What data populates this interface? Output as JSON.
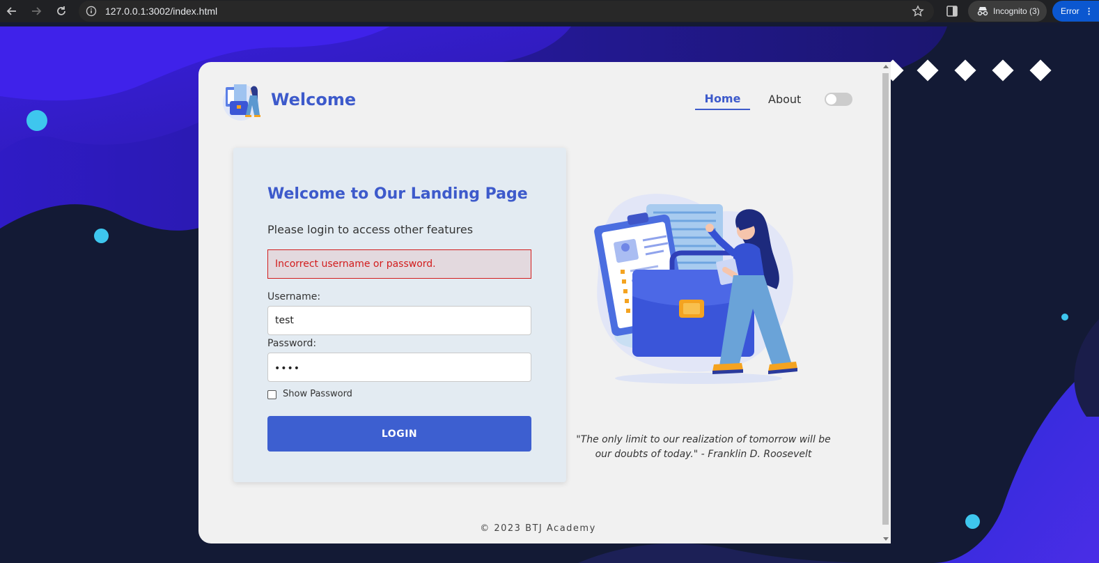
{
  "browser": {
    "url": "127.0.0.1:3002/index.html",
    "incognito_label": "Incognito (3)",
    "error_label": "Error",
    "icons": {
      "back": "arrow-left-icon",
      "forward": "arrow-right-icon",
      "reload": "reload-icon",
      "site_info": "info-icon",
      "bookmark": "star-icon",
      "side_panel": "side-panel-icon",
      "incognito": "incognito-icon",
      "menu": "kebab-menu-icon"
    }
  },
  "header": {
    "brand": "Welcome",
    "nav": {
      "home": "Home",
      "about": "About"
    },
    "theme_toggle_on": false
  },
  "login": {
    "title": "Welcome to Our Landing Page",
    "subtitle": "Please login to access other features",
    "error_message": "Incorrect username or password.",
    "username_label": "Username:",
    "username_value": "test",
    "password_label": "Password:",
    "password_masked": "••••",
    "show_password_label": "Show Password",
    "show_password_checked": false,
    "button_label": "LOGIN"
  },
  "quote": "\"The only limit to our realization of tomorrow will be our doubts of today.\" - Franklin D. Roosevelt",
  "footer": "© 2023 BTJ Academy",
  "colors": {
    "brand_blue": "#3d5acb",
    "button_blue": "#3d5fd0",
    "error_red": "#d21c1c",
    "panel_bg": "#e3ebf2",
    "card_bg": "#f1f1f1",
    "accent_cyan": "#3ec6ee"
  }
}
